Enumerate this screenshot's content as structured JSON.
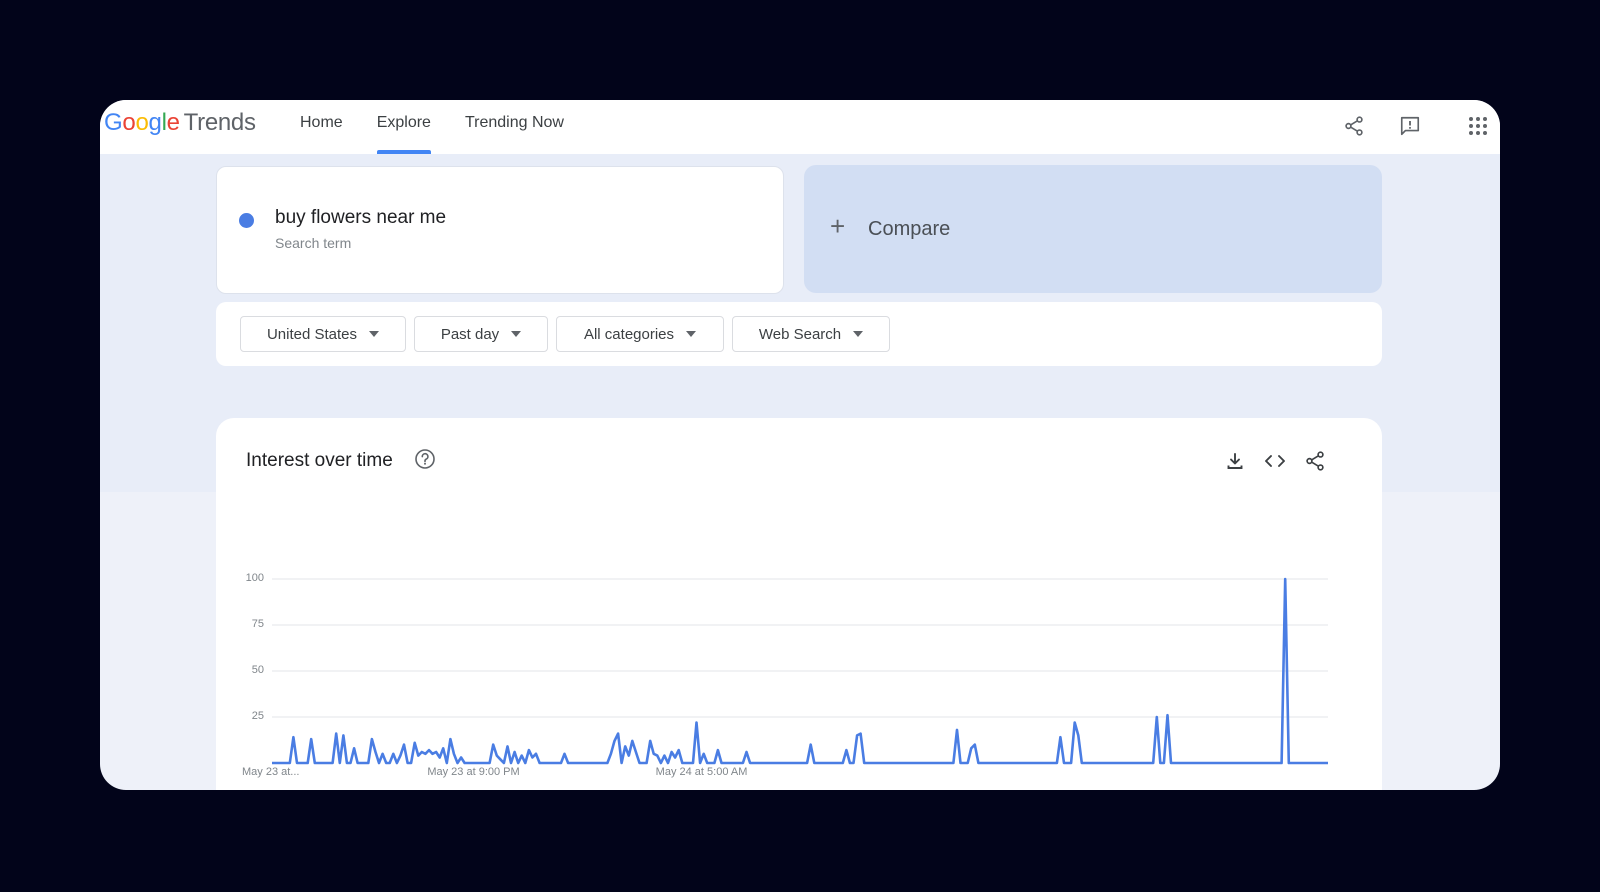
{
  "header": {
    "logo_google": [
      "G",
      "o",
      "o",
      "g",
      "l",
      "e"
    ],
    "logo_product": "Trends",
    "nav": [
      "Home",
      "Explore",
      "Trending Now"
    ],
    "active_nav": "Explore",
    "icons": [
      "share-icon",
      "feedback-icon",
      "apps-grid-icon"
    ]
  },
  "search": {
    "term": "buy flowers near me",
    "sublabel": "Search term",
    "term_color": "#4a7de3"
  },
  "compare": {
    "label": "Compare"
  },
  "filters": [
    "United States",
    "Past day",
    "All categories",
    "Web Search"
  ],
  "chart_card": {
    "title": "Interest over time",
    "icons": [
      "download-icon",
      "embed-code-icon",
      "share-icon"
    ]
  },
  "chart_data": {
    "type": "line",
    "title": "",
    "ylim": [
      0,
      100
    ],
    "yticks": [
      "100",
      "75",
      "50",
      "25"
    ],
    "xticks": [
      {
        "label": "May 23 at...",
        "index": 0
      },
      {
        "label": "May 23 at 9:00 PM",
        "index": 57
      },
      {
        "label": "May 24 at 5:00 AM",
        "index": 121
      }
    ],
    "grid": true,
    "series": [
      {
        "color": "#4a7de3",
        "values": [
          0,
          0,
          0,
          0,
          0,
          0,
          14,
          0,
          0,
          0,
          0,
          13,
          0,
          0,
          0,
          0,
          0,
          0,
          16,
          0,
          15,
          0,
          0,
          8,
          0,
          0,
          0,
          0,
          13,
          6,
          0,
          5,
          0,
          0,
          5,
          0,
          4,
          10,
          0,
          0,
          11,
          4,
          6,
          5,
          7,
          5,
          6,
          3,
          8,
          0,
          13,
          5,
          0,
          3,
          0,
          0,
          0,
          0,
          0,
          0,
          0,
          0,
          10,
          4,
          2,
          0,
          9,
          0,
          6,
          0,
          4,
          0,
          7,
          3,
          5,
          0,
          0,
          0,
          0,
          0,
          0,
          0,
          5,
          0,
          0,
          0,
          0,
          0,
          0,
          0,
          0,
          0,
          0,
          0,
          0,
          5,
          12,
          16,
          0,
          9,
          4,
          12,
          6,
          0,
          0,
          0,
          12,
          5,
          4,
          0,
          4,
          0,
          6,
          3,
          7,
          0,
          0,
          0,
          0,
          22,
          0,
          5,
          0,
          0,
          0,
          7,
          0,
          0,
          0,
          0,
          0,
          0,
          0,
          6,
          0,
          0,
          0,
          0,
          0,
          0,
          0,
          0,
          0,
          0,
          0,
          0,
          0,
          0,
          0,
          0,
          0,
          10,
          0,
          0,
          0,
          0,
          0,
          0,
          0,
          0,
          0,
          7,
          0,
          0,
          15,
          16,
          0,
          0,
          0,
          0,
          0,
          0,
          0,
          0,
          0,
          0,
          0,
          0,
          0,
          0,
          0,
          0,
          0,
          0,
          0,
          0,
          0,
          0,
          0,
          0,
          0,
          0,
          18,
          0,
          0,
          0,
          8,
          10,
          0,
          0,
          0,
          0,
          0,
          0,
          0,
          0,
          0,
          0,
          0,
          0,
          0,
          0,
          0,
          0,
          0,
          0,
          0,
          0,
          0,
          0,
          0,
          14,
          0,
          0,
          0,
          22,
          15,
          0,
          0,
          0,
          0,
          0,
          0,
          0,
          0,
          0,
          0,
          0,
          0,
          0,
          0,
          0,
          0,
          0,
          0,
          0,
          0,
          0,
          25,
          0,
          0,
          26,
          0,
          0,
          0,
          0,
          0,
          0,
          0,
          0,
          0,
          0,
          0,
          0,
          0,
          0,
          0,
          0,
          0,
          0,
          0,
          0,
          0,
          0,
          0,
          0,
          0,
          0,
          0,
          0,
          0,
          0,
          0,
          0,
          100,
          0,
          0,
          0,
          0,
          0,
          0,
          0,
          0,
          0,
          0,
          0,
          0
        ]
      }
    ]
  }
}
